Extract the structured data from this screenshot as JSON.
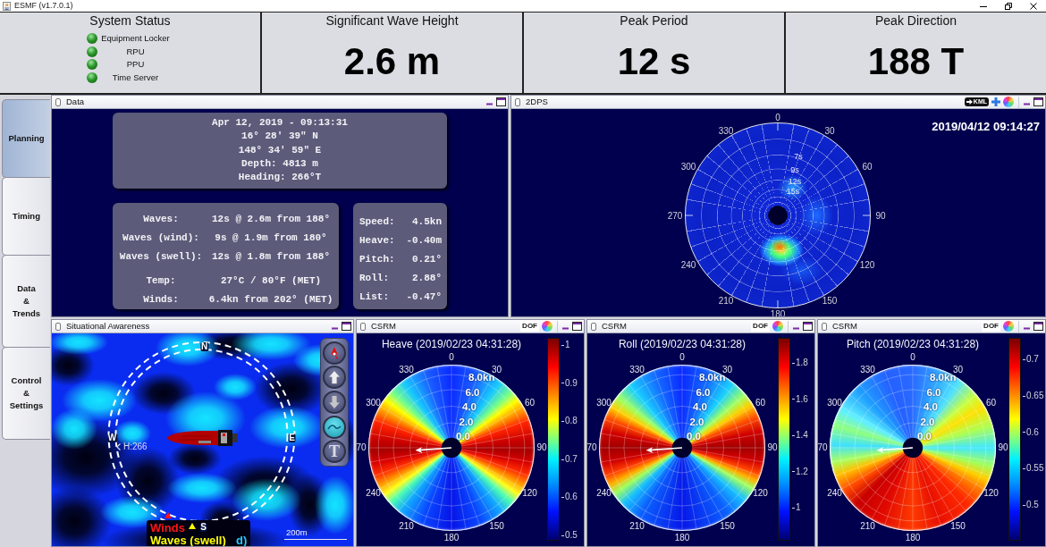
{
  "window": {
    "title": "ESMF (v1.7.0.1)"
  },
  "summary": {
    "system_status": {
      "title": "System Status",
      "items": [
        {
          "name": "Equipment Locker",
          "online": true
        },
        {
          "name": "RPU",
          "online": true
        },
        {
          "name": "PPU",
          "online": true
        },
        {
          "name": "Time Server",
          "online": true
        }
      ]
    },
    "metrics": [
      {
        "title": "Significant Wave Height",
        "value": "2.6 m"
      },
      {
        "title": "Peak Period",
        "value": "12 s"
      },
      {
        "title": "Peak Direction",
        "value": "188 T"
      }
    ]
  },
  "sidebar": {
    "tabs": [
      {
        "label": "Planning",
        "selected": true
      },
      {
        "label": "Timing",
        "selected": false
      },
      {
        "label": "Data\n&\nTrends",
        "selected": false
      },
      {
        "label": "Control\n&\nSettings",
        "selected": false
      }
    ]
  },
  "data_panel": {
    "title": "Data",
    "position_lines": [
      "Apr 12, 2019 - 09:13:31",
      "16° 28' 39\" N",
      "148° 34' 59\" E",
      "Depth: 4813 m",
      "Heading: 266°T"
    ],
    "waves": [
      {
        "label": "Waves:",
        "value": "12s @ 2.6m from 188°"
      },
      {
        "label": "Waves (wind):",
        "value": "9s @ 1.9m from 180°"
      },
      {
        "label": "Waves (swell):",
        "value": "12s @ 1.8m from 188°"
      }
    ],
    "weather": [
      {
        "label": "Temp:",
        "value": "27°C / 80°F (MET)"
      },
      {
        "label": "Winds:",
        "value": "6.4kn from 202° (MET)"
      }
    ],
    "motion": [
      {
        "label": "Speed:",
        "value": "4.5kn"
      },
      {
        "label": "Heave:",
        "value": "-0.40m"
      },
      {
        "label": "Pitch:",
        "value": "0.21°"
      },
      {
        "label": "Roll:",
        "value": "2.88°"
      },
      {
        "label": "List:",
        "value": "-0.47°"
      }
    ]
  },
  "spectrum_panel": {
    "title": "2DPS",
    "export_label": "KML",
    "timestamp": "2019/04/12 09:14:27",
    "angle_labels": [
      "0",
      "30",
      "60",
      "90",
      "120",
      "150",
      "180",
      "210",
      "240",
      "270",
      "300",
      "330"
    ],
    "period_labels": [
      "7s",
      "9s",
      "12s",
      "15s"
    ]
  },
  "awareness_panel": {
    "title": "Situational Awareness",
    "compass_labels": [
      "N",
      "E",
      "S",
      "W"
    ],
    "heading_label": "H:266",
    "legend": [
      {
        "label": "Winds",
        "color": "#ff1414",
        "marker": true
      },
      {
        "label": "Waves (swell)",
        "color": "#ffff00",
        "marker": true
      },
      {
        "label": "d)",
        "color": "#22ccff",
        "marker": false
      }
    ],
    "scale_label": "200m",
    "tools": [
      {
        "kind": "compass",
        "on": false
      },
      {
        "kind": "up",
        "on": false
      },
      {
        "kind": "down",
        "on": false
      },
      {
        "kind": "wave",
        "on": true
      },
      {
        "kind": "text",
        "label": "T",
        "on": false
      }
    ]
  },
  "csrm_panels": [
    {
      "title": "CSRM",
      "badge": "DOF",
      "kind": "heave",
      "plot_title": "Heave (2019/02/23 04:31:28)",
      "angle_labels": [
        "0",
        "30",
        "60",
        "90",
        "120",
        "150",
        "180",
        "210",
        "240",
        "70",
        "300",
        "330"
      ],
      "speed_labels": [
        "8.0kn",
        "6.0",
        "4.0",
        "2.0",
        "0.0"
      ],
      "scale_ticks": [
        "1",
        "0.9",
        "0.8",
        "0.7",
        "0.6",
        "0.5"
      ]
    },
    {
      "title": "CSRM",
      "badge": "DOF",
      "kind": "roll",
      "plot_title": "Roll (2019/02/23 04:31:28)",
      "angle_labels": [
        "0",
        "30",
        "60",
        "90",
        "120",
        "150",
        "180",
        "210",
        "240",
        "70",
        "300",
        "330"
      ],
      "speed_labels": [
        "8.0kn",
        "6.0",
        "4.0",
        "2.0",
        "0.0"
      ],
      "scale_ticks": [
        "1.8",
        "1.6",
        "1.4",
        "1.2",
        "1"
      ]
    },
    {
      "title": "CSRM",
      "badge": "DOF",
      "kind": "pitch",
      "plot_title": "Pitch (2019/02/23 04:31:28)",
      "angle_labels": [
        "0",
        "30",
        "60",
        "90",
        "120",
        "150",
        "180",
        "210",
        "240",
        "70",
        "300",
        "330"
      ],
      "speed_labels": [
        "8.0kn",
        "6.0",
        "4.0",
        "2.0",
        "0.0"
      ],
      "scale_ticks": [
        "0.7",
        "0.65",
        "0.6",
        "0.55",
        "0.5"
      ]
    }
  ]
}
